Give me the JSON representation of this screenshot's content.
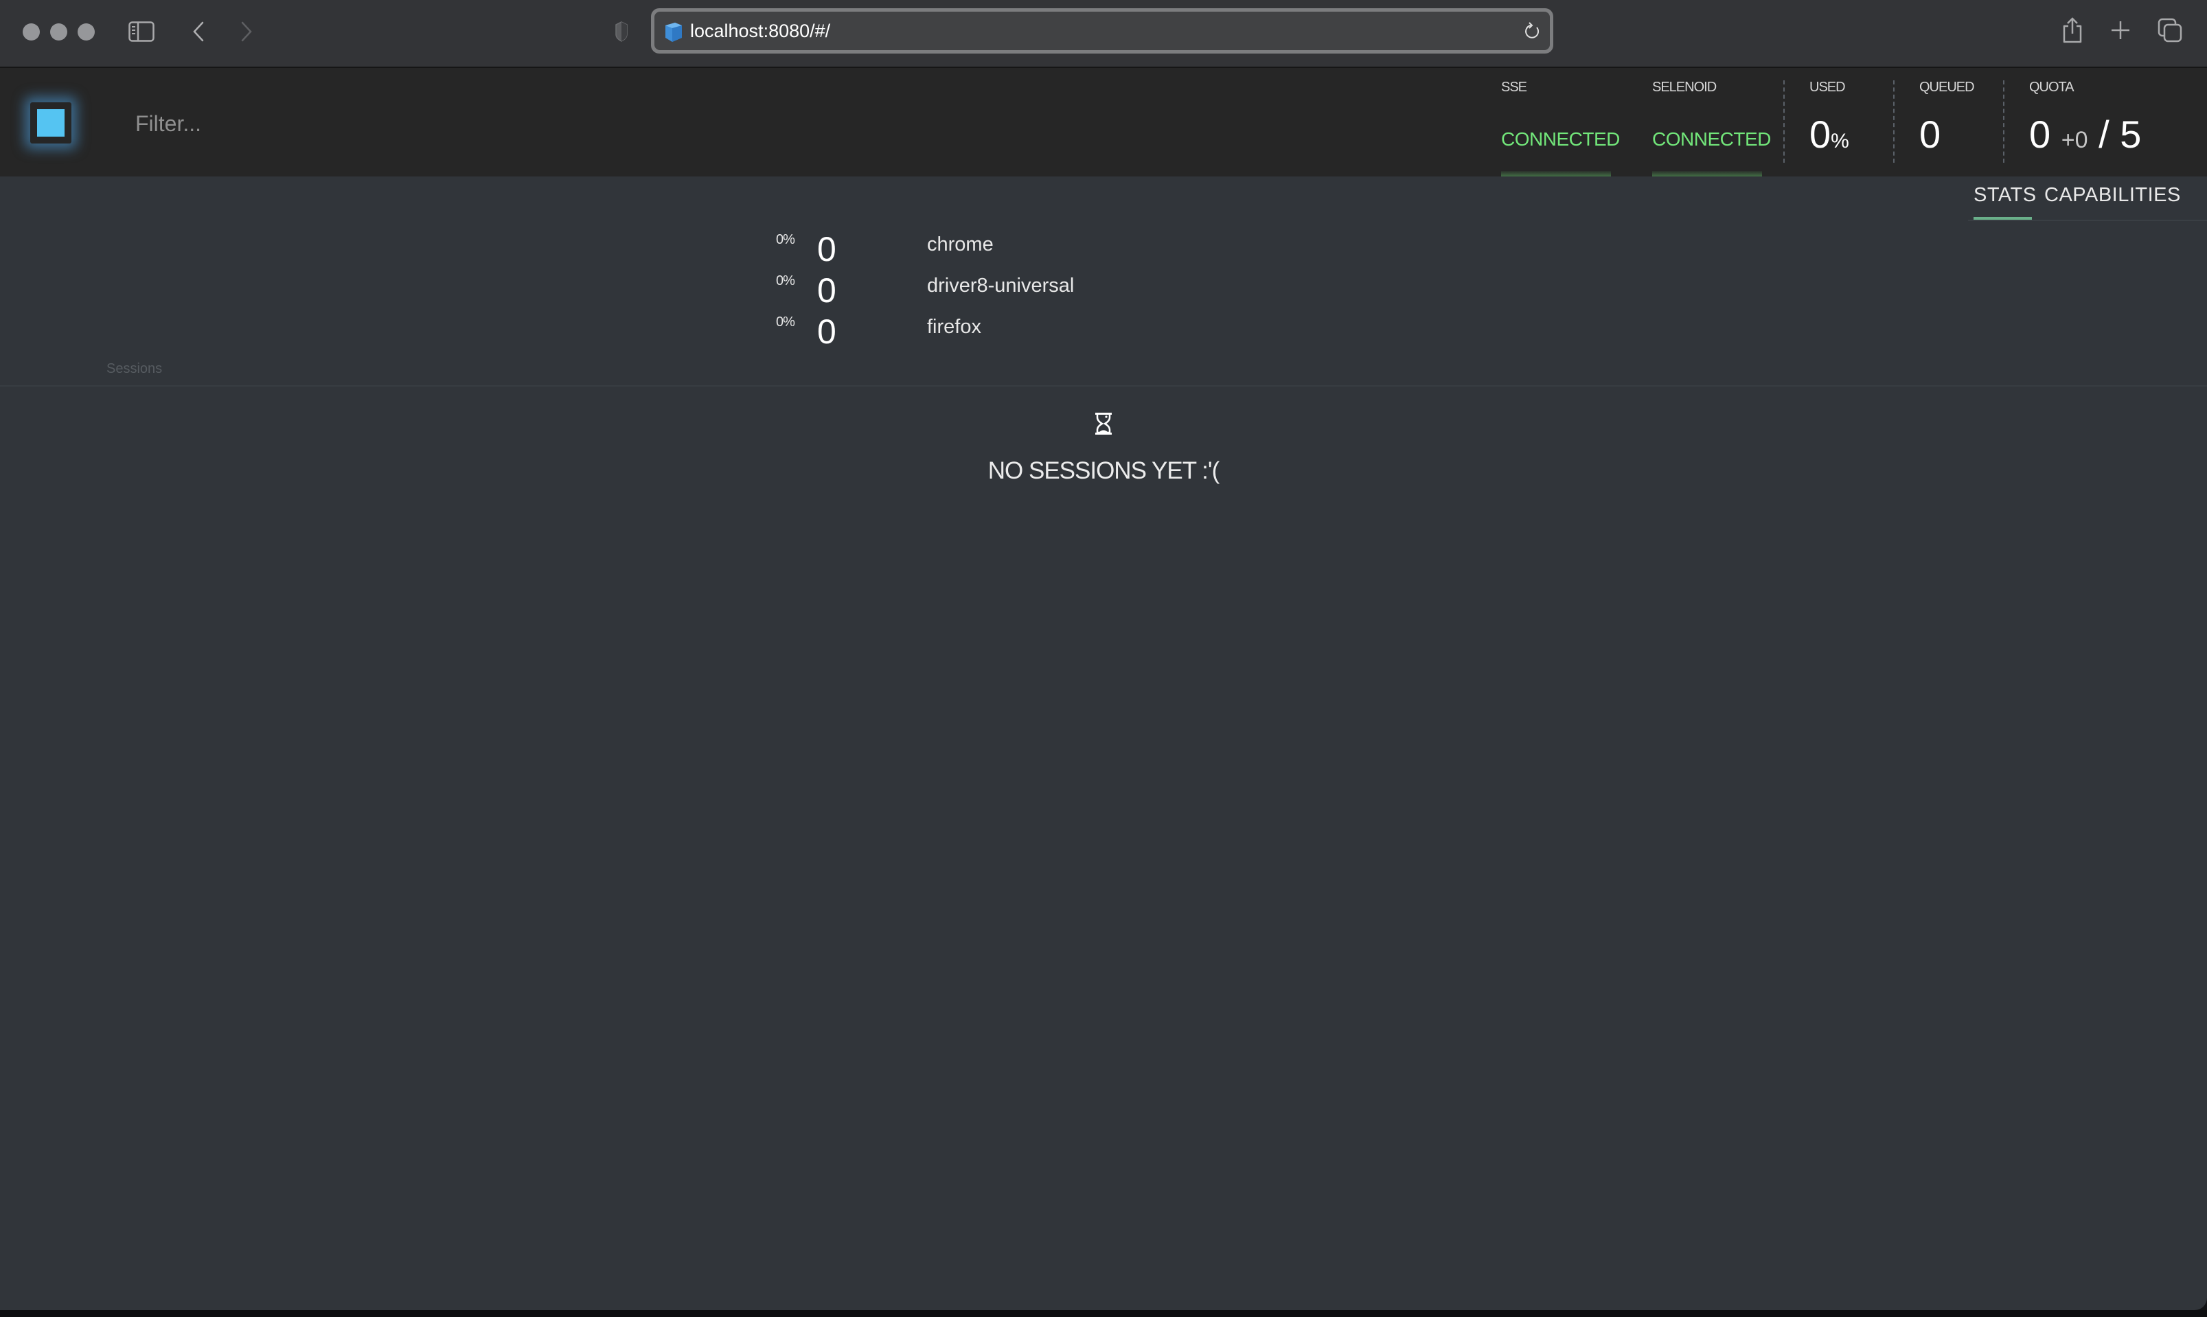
{
  "browser": {
    "url": "localhost:8080/#/",
    "icons": {
      "traffic_lights": [
        "close-icon",
        "minimize-icon",
        "zoom-icon"
      ],
      "sidebar": "sidebar-toggle-icon",
      "back": "chevron-left-icon",
      "forward": "chevron-right-icon",
      "privacy": "shield-icon",
      "site": "selenoid-cube-icon",
      "reload": "reload-icon",
      "share": "share-icon",
      "new_tab": "plus-icon",
      "tabs": "tab-overview-icon"
    }
  },
  "header": {
    "logo": "selenoid-logo",
    "filter_placeholder": "Filter...",
    "status": [
      {
        "label": "SSE",
        "value": "CONNECTED"
      },
      {
        "label": "SELENOID",
        "value": "CONNECTED"
      }
    ],
    "used": {
      "label": "USED",
      "value": "0",
      "unit": "%"
    },
    "queued": {
      "label": "QUEUED",
      "value": "0"
    },
    "quota": {
      "label": "QUOTA",
      "used": "0",
      "plus": "+",
      "pending": "0",
      "separator": "/",
      "total": "5"
    },
    "colors": {
      "connected": "#72e67a",
      "accent": "#55c4f2"
    }
  },
  "tabs": [
    {
      "label": "STATS",
      "active": true
    },
    {
      "label": "CAPABILITIES",
      "active": false
    }
  ],
  "browsers": [
    {
      "percent": "0%",
      "count": "0",
      "name": "chrome"
    },
    {
      "percent": "0%",
      "count": "0",
      "name": "driver8-universal"
    },
    {
      "percent": "0%",
      "count": "0",
      "name": "firefox"
    }
  ],
  "sessions": {
    "label": "Sessions",
    "empty_icon": "hourglass-icon",
    "empty_text": "NO SESSIONS YET :'("
  }
}
